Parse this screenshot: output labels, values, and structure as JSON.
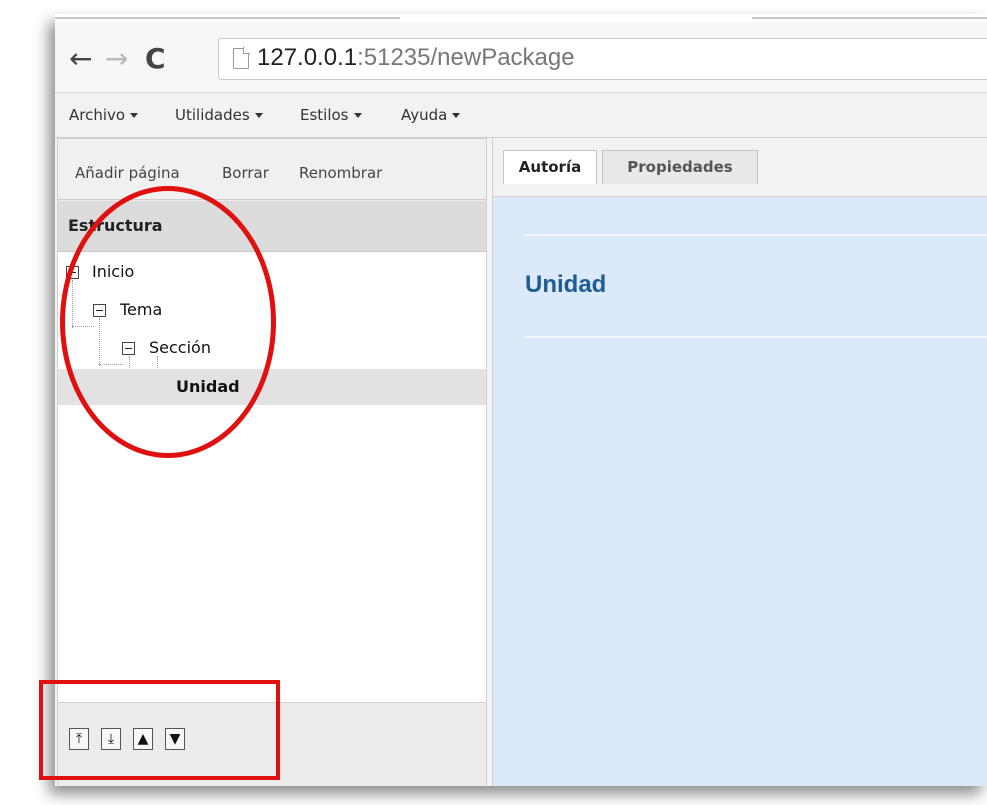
{
  "browser": {
    "url_host": "127.0.0.1",
    "url_rest": ":51235/newPackage",
    "icons": {
      "back": "arrow-left-icon",
      "forward": "arrow-right-icon",
      "reload": "reload-icon",
      "page": "page-icon"
    }
  },
  "menu": {
    "items": [
      {
        "label": "Archivo"
      },
      {
        "label": "Utilidades"
      },
      {
        "label": "Estilos"
      },
      {
        "label": "Ayuda"
      }
    ]
  },
  "left_panel": {
    "actions": [
      {
        "label": "Añadir página"
      },
      {
        "label": "Borrar"
      },
      {
        "label": "Renombrar"
      }
    ],
    "structure_title": "Estructura",
    "tree": [
      {
        "label": "Inicio",
        "level": 0,
        "expanded": true
      },
      {
        "label": "Tema",
        "level": 1,
        "expanded": true
      },
      {
        "label": "Sección",
        "level": 2,
        "expanded": true
      },
      {
        "label": "Unidad",
        "level": 3,
        "selected": true
      }
    ],
    "move_buttons": [
      {
        "name": "move-top",
        "icon": "move-top-icon"
      },
      {
        "name": "move-bottom",
        "icon": "move-bottom-icon"
      },
      {
        "name": "move-up",
        "icon": "move-up-icon"
      },
      {
        "name": "move-down",
        "icon": "move-down-icon"
      }
    ]
  },
  "tabs": [
    {
      "label": "Autoría",
      "active": true
    },
    {
      "label": "Propiedades",
      "active": false
    }
  ],
  "content": {
    "node_title": "Unidad"
  },
  "colors": {
    "content_bg": "#dce9fb",
    "title": "#1e5d91",
    "annotation": "#e01010"
  }
}
